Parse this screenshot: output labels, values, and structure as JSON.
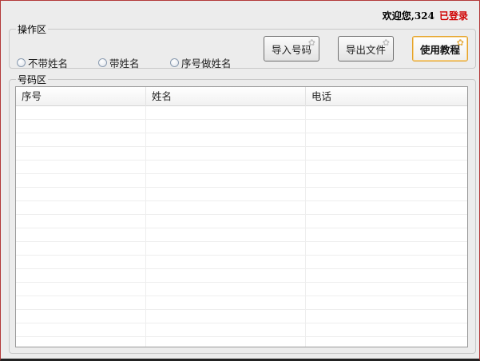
{
  "header": {
    "welcome": "欢迎您,324",
    "status": "已登录",
    "status_color": "#d00000"
  },
  "operations": {
    "legend": "操作区",
    "radio_options": [
      "不带姓名",
      "带姓名",
      "序号做姓名"
    ],
    "buttons": {
      "import_label": "导入号码",
      "export_label": "导出文件",
      "tutorial_label": "使用教程"
    },
    "accent_color": "#e5a32b"
  },
  "numbers": {
    "legend": "号码区",
    "columns": [
      "序号",
      "姓名",
      "电话"
    ],
    "rows": []
  }
}
